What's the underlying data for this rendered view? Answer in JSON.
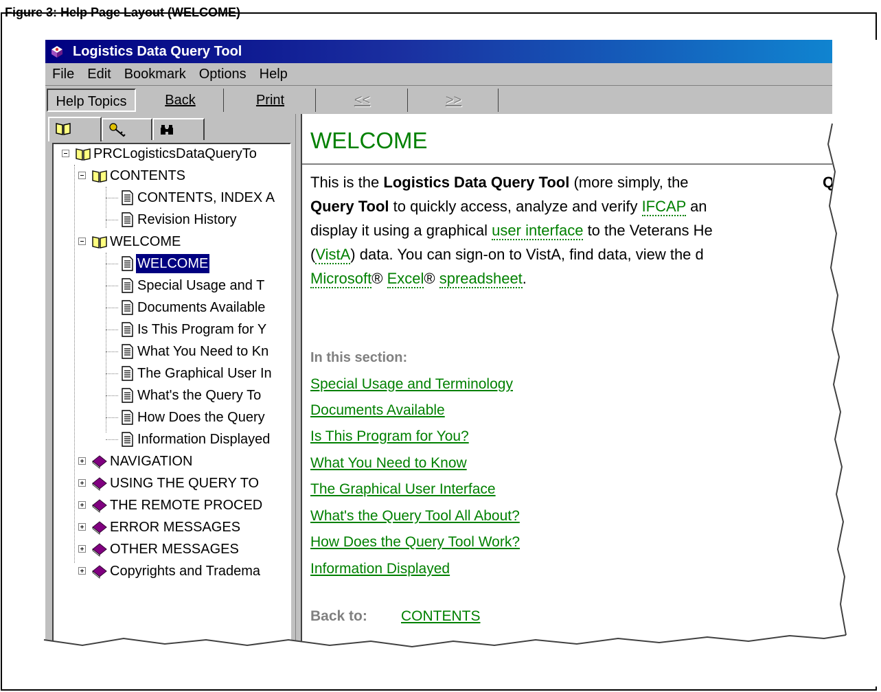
{
  "caption": "Figure 3: Help Page Layout (WELCOME)",
  "window": {
    "title": "Logistics Data Query Tool",
    "menu": [
      "File",
      "Edit",
      "Bookmark",
      "Options",
      "Help"
    ],
    "toolbar": {
      "help_topics": "Help Topics",
      "back": "Back",
      "print": "Print",
      "prev": "<<",
      "next": ">>"
    }
  },
  "tabs": [
    "contents-tab (book icon)",
    "index-tab (key icon)",
    "find-tab (binoculars icon)"
  ],
  "tree": {
    "root": "PRCLogisticsDataQueryTo",
    "contents_book": "CONTENTS",
    "contents_pages": [
      "CONTENTS, INDEX A",
      "Revision History"
    ],
    "welcome_book": "WELCOME",
    "welcome_pages": [
      "WELCOME",
      "Special Usage and T",
      "Documents Available",
      "Is This Program for Y",
      "What You Need to Kn",
      "The Graphical User In",
      "What's the Query To",
      "How Does the Query",
      "Information Displayed"
    ],
    "closed_books": [
      "NAVIGATION",
      "USING THE QUERY TO",
      "THE REMOTE PROCED",
      "ERROR MESSAGES",
      "OTHER MESSAGES",
      "Copyrights and Tradema"
    ]
  },
  "content": {
    "heading": "WELCOME",
    "para": {
      "t1": "This is the ",
      "b1": "Logistics Data Query Tool",
      "t2": " (more simply, the ",
      "b2": "Query Tool",
      "t3": " to quickly access, analyze and verify ",
      "g1": "IFCAP",
      "t4": " an",
      "t5": "display it using a graphical ",
      "g2": "user interface",
      "t6": " to the Veterans He",
      "t7": "(",
      "g3": "VistA",
      "t8": ") data.  You can sign-on to VistA, find data, view the d",
      "g4": "Microsoft",
      "t9": "® ",
      "g5": "Excel",
      "t10": "® ",
      "g6": "spreadsheet",
      "t11": "."
    },
    "section_label": "In this section:",
    "section_links": [
      "Special Usage and Terminology",
      "Documents Available",
      "Is This Program for You?",
      "What You Need to Know",
      "The Graphical User Interface",
      "What's the Query Tool All About?",
      "How Does the Query Tool Work?",
      "Information Displayed"
    ],
    "back_to_label": "Back to:",
    "back_to_link": "CONTENTS"
  },
  "colors": {
    "link": "#008000",
    "titlebar": "#000080",
    "selection": "#000080",
    "window_bg": "#c0c0c0"
  }
}
